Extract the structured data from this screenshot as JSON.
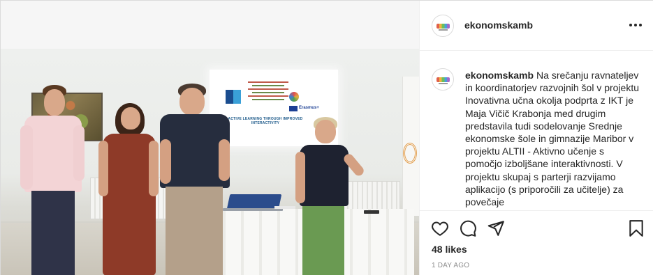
{
  "post": {
    "username": "ekonomskamb",
    "caption": "Na srečanju ravnateljev in koordinatorjev razvojnih šol v projektu Inovativna učna okolja podprta z IKT je Maja Vičič Krabonja med drugim predstavila tudi sodelovanje Srednje ekonomske šole in gimnazije Maribor v projektu ALTII - Aktivno učenje s pomočjo izboljšane interaktivnosti. V projektu skupaj s parterji razvijamo aplikacijo (s priporočili za učitelje) za povečaje",
    "likes": "48 likes",
    "timestamp": "1 DAY AGO"
  },
  "photo": {
    "screen_title": "ACTIVE LEARNING THROUGH IMPROVED INTERACTIVITY",
    "screen_erasmus": "Erasmus+"
  },
  "icons": {
    "more": "more-options-icon",
    "like": "heart-icon",
    "comment": "comment-icon",
    "share": "paper-plane-icon",
    "save": "bookmark-icon"
  }
}
